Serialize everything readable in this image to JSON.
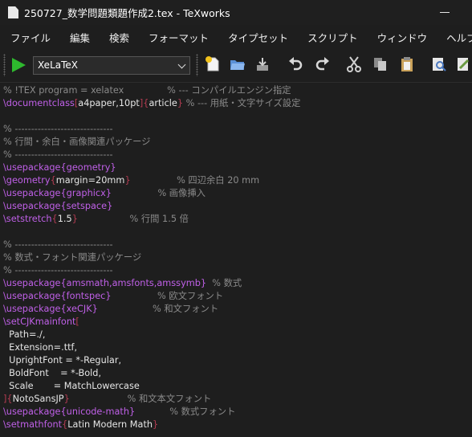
{
  "window": {
    "title": "250727_数学問題類題作成2.tex - TeXworks"
  },
  "menu": [
    "ファイル",
    "編集",
    "検索",
    "フォーマット",
    "タイプセット",
    "スクリプト",
    "ウィンドウ",
    "ヘルプ"
  ],
  "toolbar": {
    "engine": "XeLaTeX",
    "icons": [
      "typeset-play-icon",
      "new-file-icon",
      "open-folder-icon",
      "save-icon",
      "undo-icon",
      "redo-icon",
      "cut-icon",
      "copy-icon",
      "paste-icon",
      "find-icon",
      "replace-icon"
    ]
  },
  "editor": {
    "lines": [
      [
        [
          "c",
          "% !TEX program = xelatex               % --- コンパイルエンジン指定"
        ]
      ],
      [
        [
          "k",
          "\\documentclass"
        ],
        [
          "r",
          "["
        ],
        [
          "n",
          "a4paper,10pt"
        ],
        [
          "r",
          "]{"
        ],
        [
          "n",
          "article"
        ],
        [
          "r",
          "}"
        ],
        [
          "c",
          " % --- 用紙・文字サイズ設定"
        ]
      ],
      [
        [
          "n",
          ""
        ]
      ],
      [
        [
          "c",
          "% ------------------------------"
        ]
      ],
      [
        [
          "c",
          "% 行間・余白・画像関連パッケージ"
        ]
      ],
      [
        [
          "c",
          "% ------------------------------"
        ]
      ],
      [
        [
          "k",
          "\\usepackage{geometry}"
        ]
      ],
      [
        [
          "k",
          "\\geometry"
        ],
        [
          "r",
          "{"
        ],
        [
          "n",
          "margin=20mm"
        ],
        [
          "r",
          "}"
        ],
        [
          "c",
          "                % 四辺余白 20 mm"
        ]
      ],
      [
        [
          "k",
          "\\usepackage{graphicx}"
        ],
        [
          "c",
          "                % 画像挿入"
        ]
      ],
      [
        [
          "k",
          "\\usepackage{setspace}"
        ]
      ],
      [
        [
          "k",
          "\\setstretch"
        ],
        [
          "r",
          "{"
        ],
        [
          "n",
          "1.5"
        ],
        [
          "r",
          "}"
        ],
        [
          "c",
          "                  % 行間 1.5 倍"
        ]
      ],
      [
        [
          "n",
          ""
        ]
      ],
      [
        [
          "c",
          "% ------------------------------"
        ]
      ],
      [
        [
          "c",
          "% 数式・フォント関連パッケージ"
        ]
      ],
      [
        [
          "c",
          "% ------------------------------"
        ]
      ],
      [
        [
          "k",
          "\\usepackage{amsmath,amsfonts,amssymb}"
        ],
        [
          "c",
          "  % 数式"
        ]
      ],
      [
        [
          "k",
          "\\usepackage{fontspec}"
        ],
        [
          "c",
          "                % 欧文フォント"
        ]
      ],
      [
        [
          "k",
          "\\usepackage{xeCJK}"
        ],
        [
          "c",
          "                   % 和文フォント"
        ]
      ],
      [
        [
          "k",
          "\\setCJKmainfont"
        ],
        [
          "r",
          "["
        ]
      ],
      [
        [
          "n",
          "  Path=./,"
        ]
      ],
      [
        [
          "n",
          "  Extension=.ttf,"
        ]
      ],
      [
        [
          "n",
          "  UprightFont = *-Regular,"
        ]
      ],
      [
        [
          "n",
          "  BoldFont    = *-Bold,"
        ]
      ],
      [
        [
          "n",
          "  Scale       = MatchLowercase"
        ]
      ],
      [
        [
          "r",
          "]{"
        ],
        [
          "n",
          "NotoSansJP"
        ],
        [
          "r",
          "}"
        ],
        [
          "c",
          "                    % 和文本文フォント"
        ]
      ],
      [
        [
          "k",
          "\\usepackage{unicode-math}"
        ],
        [
          "c",
          "            % 数式フォント"
        ]
      ],
      [
        [
          "k",
          "\\setmathfont"
        ],
        [
          "r",
          "{"
        ],
        [
          "n",
          "Latin Modern Math"
        ],
        [
          "r",
          "}"
        ]
      ]
    ]
  }
}
